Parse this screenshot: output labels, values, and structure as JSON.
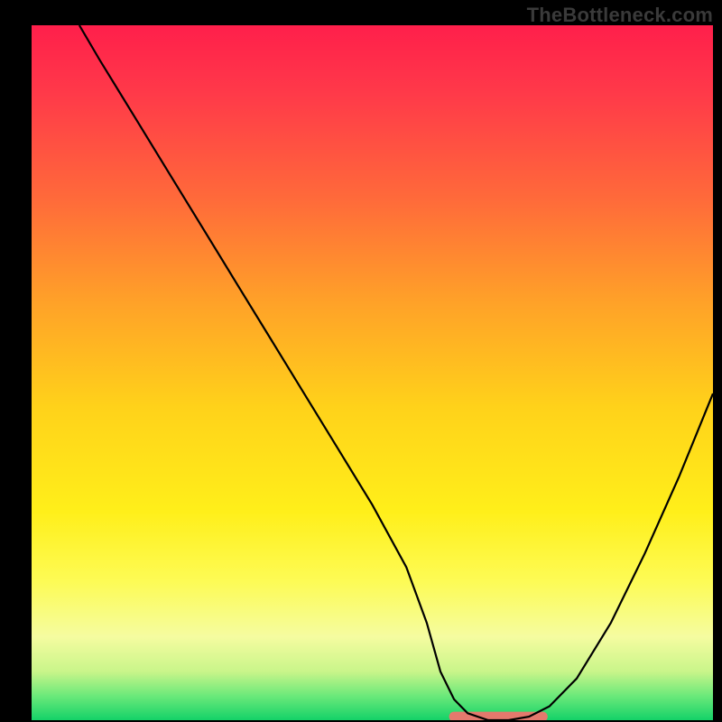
{
  "watermark": "TheBottleneck.com",
  "chart_data": {
    "type": "line",
    "title": "",
    "xlabel": "",
    "ylabel": "",
    "xlim": [
      0,
      100
    ],
    "ylim": [
      0,
      100
    ],
    "series": [
      {
        "name": "bottleneck-curve",
        "x": [
          7,
          10,
          15,
          20,
          25,
          30,
          35,
          40,
          45,
          50,
          55,
          58,
          60,
          62,
          64,
          67,
          70,
          73,
          76,
          80,
          85,
          90,
          95,
          100
        ],
        "y": [
          100,
          95,
          87,
          79,
          71,
          63,
          55,
          47,
          39,
          31,
          22,
          14,
          7,
          3,
          1,
          0,
          0,
          0.5,
          2,
          6,
          14,
          24,
          35,
          47
        ]
      }
    ],
    "flat_region": {
      "x_start": 62,
      "x_end": 75,
      "y": 0.5
    },
    "gradient_stops": [
      {
        "offset": 0.0,
        "color": "#ff1f4b"
      },
      {
        "offset": 0.1,
        "color": "#ff3a49"
      },
      {
        "offset": 0.25,
        "color": "#ff6a3a"
      },
      {
        "offset": 0.4,
        "color": "#ffa228"
      },
      {
        "offset": 0.55,
        "color": "#ffd21a"
      },
      {
        "offset": 0.7,
        "color": "#ffef1a"
      },
      {
        "offset": 0.8,
        "color": "#fdfb55"
      },
      {
        "offset": 0.88,
        "color": "#f5fca0"
      },
      {
        "offset": 0.93,
        "color": "#c9f58a"
      },
      {
        "offset": 0.965,
        "color": "#6be97a"
      },
      {
        "offset": 1.0,
        "color": "#14d268"
      }
    ],
    "accent_color": "#e4796d",
    "curve_color": "#000000"
  }
}
